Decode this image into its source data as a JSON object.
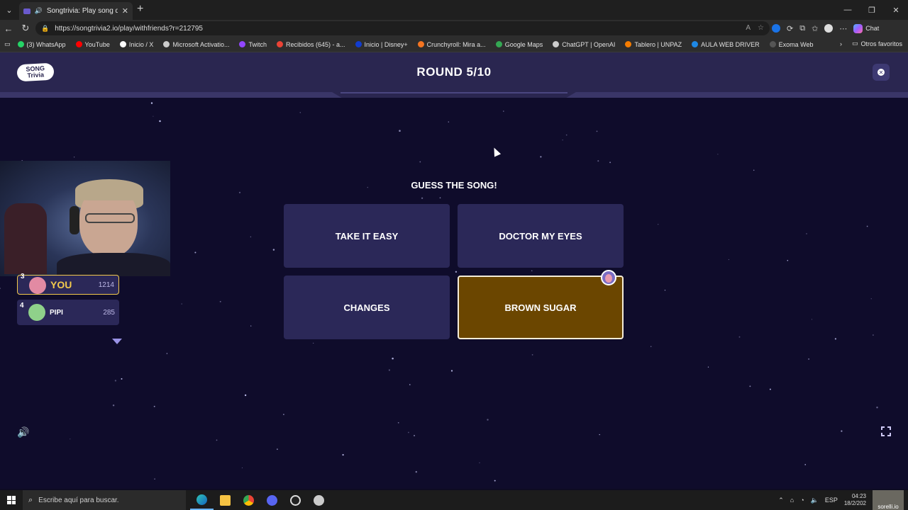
{
  "browser": {
    "tab_title": "Songtrivia: Play song quizzes",
    "url": "https://songtrivia2.io/play/withfriends?r=212795",
    "chat_label": "Chat",
    "bookmarks": [
      {
        "label": "(3) WhatsApp",
        "color": "#25d366"
      },
      {
        "label": "YouTube",
        "color": "#ff0000"
      },
      {
        "label": "Inicio / X",
        "color": "#ffffff"
      },
      {
        "label": "Microsoft Activatio...",
        "color": "#cccccc"
      },
      {
        "label": "Twitch",
        "color": "#9146ff"
      },
      {
        "label": "Recibidos (645) - a...",
        "color": "#ea4335"
      },
      {
        "label": "Inicio | Disney+",
        "color": "#113ccf"
      },
      {
        "label": "Crunchyroll: Mira a...",
        "color": "#f47521"
      },
      {
        "label": "Google Maps",
        "color": "#34a853"
      },
      {
        "label": "ChatGPT | OpenAI",
        "color": "#cccccc"
      },
      {
        "label": "Tablero | UNPAZ",
        "color": "#f57c00"
      },
      {
        "label": "AULA WEB DRIVER",
        "color": "#1e88e5"
      },
      {
        "label": "Exoma Web",
        "color": "#555555"
      }
    ],
    "other_favorites": "Otros favoritos"
  },
  "game": {
    "round_title": "ROUND 5/10",
    "prompt": "GUESS THE SONG!",
    "answers": [
      {
        "label": "TAKE IT EASY",
        "selected": false
      },
      {
        "label": "DOCTOR MY EYES",
        "selected": false
      },
      {
        "label": "CHANGES",
        "selected": false
      },
      {
        "label": "BROWN SUGAR",
        "selected": true
      }
    ],
    "leaderboard": [
      {
        "rank": "3",
        "name": "YOU",
        "score": "1214",
        "highlight": true
      },
      {
        "rank": "4",
        "name": "PIPI",
        "score": "285",
        "highlight": false
      }
    ],
    "colors": {
      "selected_answer": "#6b4600",
      "answer_bg": "#2b2858",
      "header_bg": "#2a2650",
      "you_border": "#f2c94c"
    }
  },
  "taskbar": {
    "search_placeholder": "Escribe aquí para buscar.",
    "lang": "ESP",
    "time": "04:23",
    "date": "18/2/202",
    "user_label": "sorelli.io"
  }
}
